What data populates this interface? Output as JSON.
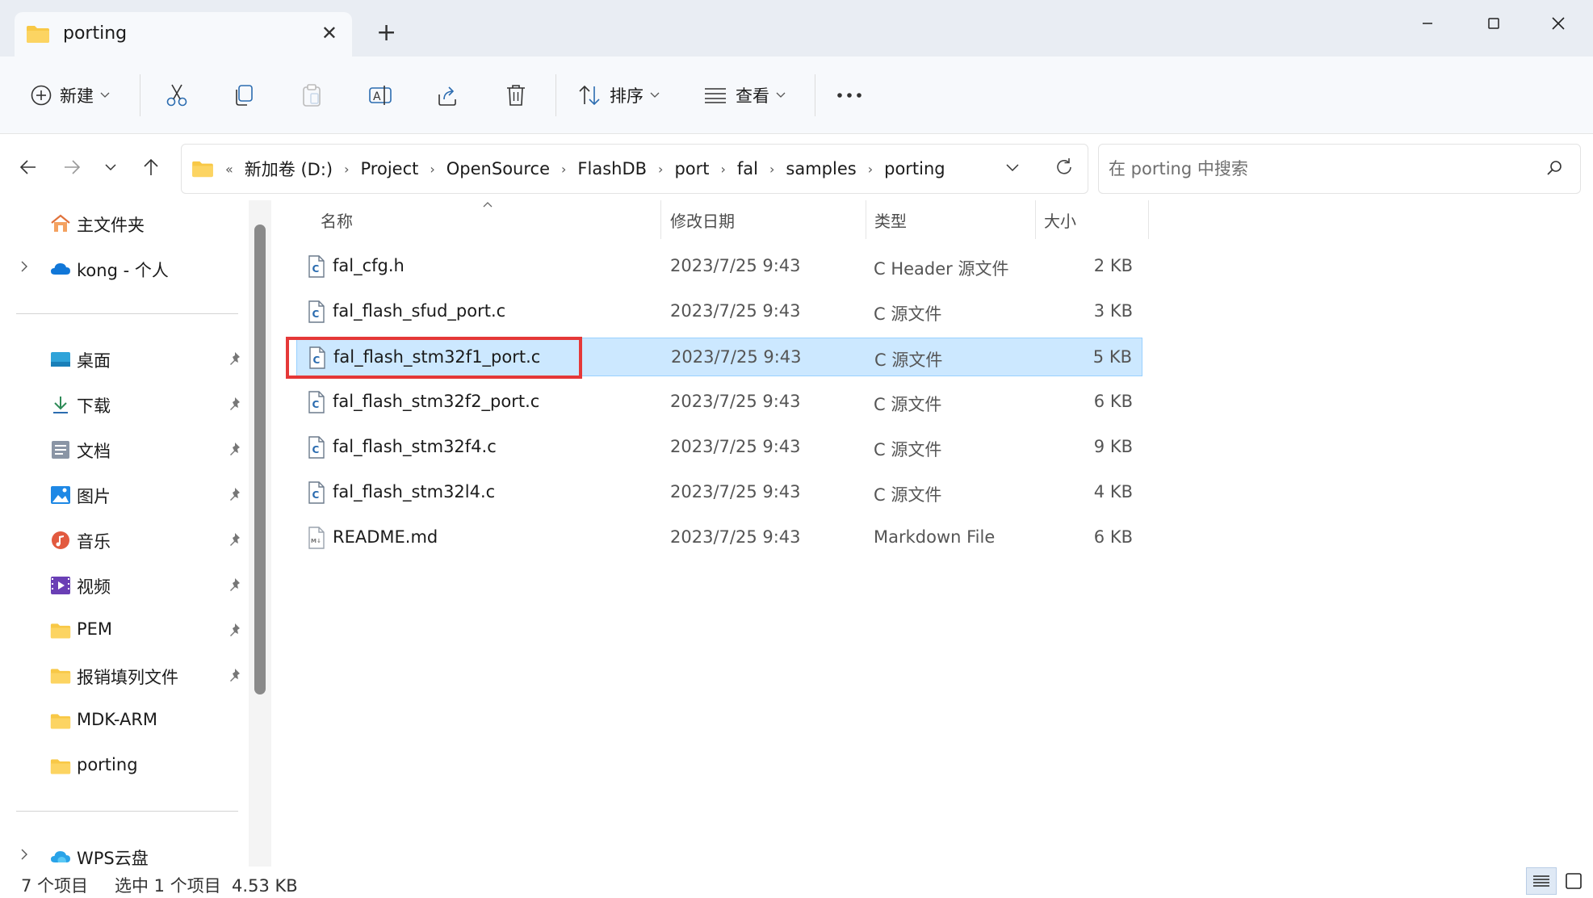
{
  "window": {
    "tab_title": "porting"
  },
  "toolbar": {
    "new_label": "新建",
    "sort_label": "排序",
    "view_label": "查看"
  },
  "address": {
    "breadcrumbs": [
      "新加卷 (D:)",
      "Project",
      "OpenSource",
      "FlashDB",
      "port",
      "fal",
      "samples",
      "porting"
    ],
    "search_placeholder": "在 porting 中搜索"
  },
  "sidebar": {
    "items": [
      {
        "label": "主文件夹",
        "icon": "home-icon"
      },
      {
        "label": "kong - 个人",
        "icon": "cloud-icon"
      },
      {
        "label": "桌面",
        "icon": "desktop-icon"
      },
      {
        "label": "下载",
        "icon": "download-icon"
      },
      {
        "label": "文档",
        "icon": "document-icon"
      },
      {
        "label": "图片",
        "icon": "pictures-icon"
      },
      {
        "label": "音乐",
        "icon": "music-icon"
      },
      {
        "label": "视频",
        "icon": "video-icon"
      },
      {
        "label": "PEM",
        "icon": "folder-icon"
      },
      {
        "label": "报销填列文件",
        "icon": "folder-icon"
      },
      {
        "label": "MDK-ARM",
        "icon": "folder-icon"
      },
      {
        "label": "porting",
        "icon": "folder-icon"
      },
      {
        "label": "WPS云盘",
        "icon": "wps-cloud-icon"
      }
    ]
  },
  "columns": {
    "name": "名称",
    "modified": "修改日期",
    "type": "类型",
    "size": "大小"
  },
  "files": [
    {
      "name": "fal_cfg.h",
      "modified": "2023/7/25 9:43",
      "type": "C Header 源文件",
      "size": "2 KB",
      "icon": "c-file-icon"
    },
    {
      "name": "fal_flash_sfud_port.c",
      "modified": "2023/7/25 9:43",
      "type": "C 源文件",
      "size": "3 KB",
      "icon": "c-file-icon"
    },
    {
      "name": "fal_flash_stm32f1_port.c",
      "modified": "2023/7/25 9:43",
      "type": "C 源文件",
      "size": "5 KB",
      "icon": "c-file-icon",
      "selected": true
    },
    {
      "name": "fal_flash_stm32f2_port.c",
      "modified": "2023/7/25 9:43",
      "type": "C 源文件",
      "size": "6 KB",
      "icon": "c-file-icon"
    },
    {
      "name": "fal_flash_stm32f4.c",
      "modified": "2023/7/25 9:43",
      "type": "C 源文件",
      "size": "9 KB",
      "icon": "c-file-icon"
    },
    {
      "name": "fal_flash_stm32l4.c",
      "modified": "2023/7/25 9:43",
      "type": "C 源文件",
      "size": "4 KB",
      "icon": "c-file-icon"
    },
    {
      "name": "README.md",
      "modified": "2023/7/25 9:43",
      "type": "Markdown File",
      "size": "6 KB",
      "icon": "markdown-file-icon"
    }
  ],
  "status": {
    "item_count": "7 个项目",
    "selection": "选中 1 个项目  4.53 KB"
  },
  "colors": {
    "selection_bg": "#cce8ff",
    "selection_border": "#99d1ff",
    "highlight_box": "#e53838",
    "folder": "#f8c846"
  }
}
